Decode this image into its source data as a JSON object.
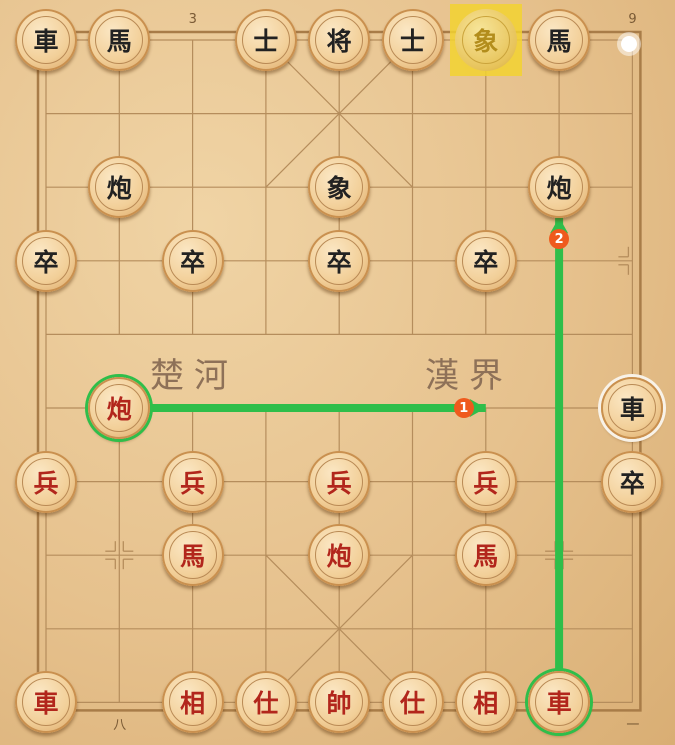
{
  "coords": {
    "top": [
      {
        "label": "3",
        "col": 2
      },
      {
        "label": "9",
        "col": 8
      }
    ],
    "bottom": [
      {
        "label": "八",
        "col": 1
      },
      {
        "label": "一",
        "col": 8
      }
    ]
  },
  "river": {
    "left": "楚河",
    "right": "漢界"
  },
  "colors": {
    "arrow": "#2fbe4a",
    "step_badge": "#ef5a1d",
    "highlight": "#f2d230"
  },
  "pieces": [
    {
      "char": "車",
      "side": "black",
      "col": 0,
      "row": 0
    },
    {
      "char": "馬",
      "side": "black",
      "col": 1,
      "row": 0
    },
    {
      "char": "士",
      "side": "black",
      "col": 3,
      "row": 0
    },
    {
      "char": "将",
      "side": "black",
      "col": 4,
      "row": 0
    },
    {
      "char": "士",
      "side": "black",
      "col": 5,
      "row": 0
    },
    {
      "char": "象",
      "side": "black",
      "col": 6,
      "row": 0,
      "state": "last-move-origin"
    },
    {
      "char": "馬",
      "side": "black",
      "col": 7,
      "row": 0
    },
    {
      "char": "炮",
      "side": "black",
      "col": 1,
      "row": 2
    },
    {
      "char": "象",
      "side": "black",
      "col": 4,
      "row": 2
    },
    {
      "char": "炮",
      "side": "black",
      "col": 7,
      "row": 2
    },
    {
      "char": "卒",
      "side": "black",
      "col": 0,
      "row": 3
    },
    {
      "char": "卒",
      "side": "black",
      "col": 2,
      "row": 3
    },
    {
      "char": "卒",
      "side": "black",
      "col": 4,
      "row": 3
    },
    {
      "char": "卒",
      "side": "black",
      "col": 6,
      "row": 3
    },
    {
      "char": "車",
      "side": "black",
      "col": 8,
      "row": 5,
      "state": "selected-white"
    },
    {
      "char": "卒",
      "side": "black",
      "col": 8,
      "row": 6
    },
    {
      "char": "炮",
      "side": "red",
      "col": 1,
      "row": 5,
      "state": "selected"
    },
    {
      "char": "兵",
      "side": "red",
      "col": 0,
      "row": 6
    },
    {
      "char": "兵",
      "side": "red",
      "col": 2,
      "row": 6
    },
    {
      "char": "兵",
      "side": "red",
      "col": 4,
      "row": 6
    },
    {
      "char": "兵",
      "side": "red",
      "col": 6,
      "row": 6
    },
    {
      "char": "馬",
      "side": "red",
      "col": 2,
      "row": 7
    },
    {
      "char": "炮",
      "side": "red",
      "col": 4,
      "row": 7
    },
    {
      "char": "馬",
      "side": "red",
      "col": 6,
      "row": 7
    },
    {
      "char": "車",
      "side": "red",
      "col": 0,
      "row": 9
    },
    {
      "char": "相",
      "side": "red",
      "col": 2,
      "row": 9
    },
    {
      "char": "仕",
      "side": "red",
      "col": 3,
      "row": 9
    },
    {
      "char": "帥",
      "side": "red",
      "col": 4,
      "row": 9
    },
    {
      "char": "仕",
      "side": "red",
      "col": 5,
      "row": 9
    },
    {
      "char": "相",
      "side": "red",
      "col": 6,
      "row": 9
    },
    {
      "char": "車",
      "side": "red",
      "col": 7,
      "row": 9,
      "state": "selected"
    }
  ],
  "hint_moves": [
    {
      "step": "1",
      "from": {
        "col": 1,
        "row": 5
      },
      "to": {
        "col": 6,
        "row": 5
      }
    },
    {
      "step": "2",
      "from": {
        "col": 7,
        "row": 9
      },
      "to": {
        "col": 7,
        "row": 2
      }
    }
  ]
}
